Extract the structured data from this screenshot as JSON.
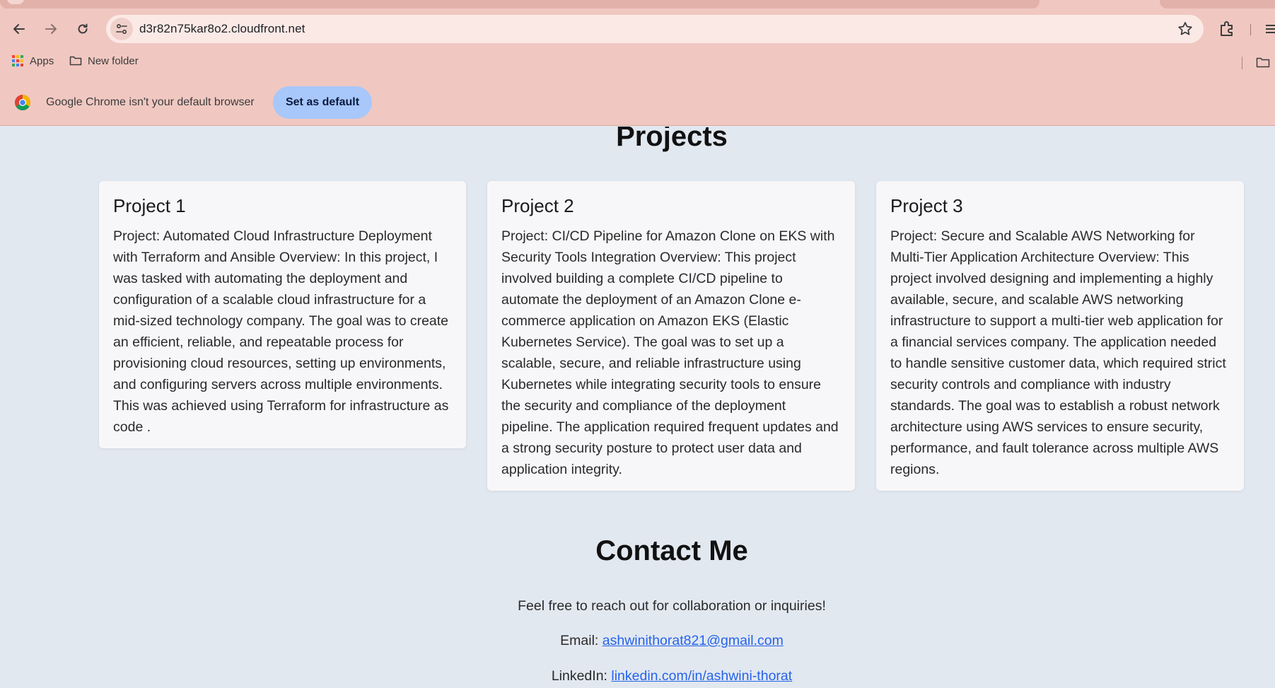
{
  "browser": {
    "url": "d3r82n75kar8o2.cloudfront.net",
    "bookmarks": [
      {
        "label": "Apps",
        "icon": "apps-grid-icon"
      },
      {
        "label": "New folder",
        "icon": "folder-icon"
      }
    ],
    "infobar": {
      "message": "Google Chrome isn't your default browser",
      "button_label": "Set as default"
    }
  },
  "projects": {
    "title": "Projects",
    "cards": [
      {
        "title": "Project 1",
        "body": "Project: Automated Cloud Infrastructure Deployment with Terraform and Ansible Overview: In this project, I was tasked with automating the deployment and configuration of a scalable cloud infrastructure for a mid-sized technology company. The goal was to create an efficient, reliable, and repeatable process for provisioning cloud resources, setting up environments, and configuring servers across multiple environments. This was achieved using Terraform for infrastructure as code ."
      },
      {
        "title": "Project 2",
        "body": "Project: CI/CD Pipeline for Amazon Clone on EKS with Security Tools Integration Overview: This project involved building a complete CI/CD pipeline to automate the deployment of an Amazon Clone e-commerce application on Amazon EKS (Elastic Kubernetes Service). The goal was to set up a scalable, secure, and reliable infrastructure using Kubernetes while integrating security tools to ensure the security and compliance of the deployment pipeline. The application required frequent updates and a strong security posture to protect user data and application integrity."
      },
      {
        "title": "Project 3",
        "body": "Project: Secure and Scalable AWS Networking for Multi-Tier Application Architecture Overview: This project involved designing and implementing a highly available, secure, and scalable AWS networking infrastructure to support a multi-tier web application for a financial services company. The application needed to handle sensitive customer data, which required strict security controls and compliance with industry standards. The goal was to establish a robust network architecture using AWS services to ensure security, performance, and fault tolerance across multiple AWS regions."
      }
    ]
  },
  "contact": {
    "title": "Contact Me",
    "intro": "Feel free to reach out for collaboration or inquiries!",
    "email_label": "Email:",
    "email": "ashwinithorat821@gmail.com",
    "linkedin_label": "LinkedIn:",
    "linkedin": "linkedin.com/in/ashwini-thorat"
  },
  "colors": {
    "chrome_bg": "#f0c8c1",
    "page_bg": "#e2e8f0",
    "link": "#2563eb",
    "default_button": "#a8c7fa"
  }
}
